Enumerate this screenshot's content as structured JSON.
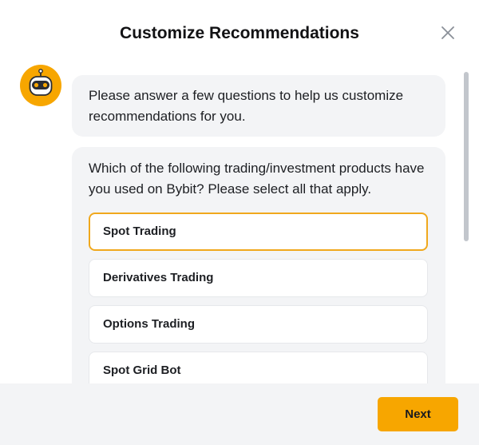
{
  "dialog": {
    "title": "Customize Recommendations"
  },
  "icons": {
    "close": "close-icon",
    "avatar": "robot-icon"
  },
  "chat": {
    "intro": "Please answer a few questions to help us customize recommendations for you.",
    "question": "Which of the following trading/investment products have you used on Bybit? Please select all that apply."
  },
  "options": [
    {
      "label": "Spot Trading",
      "selected": true
    },
    {
      "label": "Derivatives Trading",
      "selected": false
    },
    {
      "label": "Options Trading",
      "selected": false
    },
    {
      "label": "Spot Grid Bot",
      "selected": false
    }
  ],
  "footer": {
    "next_label": "Next"
  },
  "colors": {
    "accent": "#f7a600",
    "selected_border": "#f0a81d",
    "bubble_bg": "#f3f4f6",
    "footer_bg": "#f3f4f6"
  }
}
